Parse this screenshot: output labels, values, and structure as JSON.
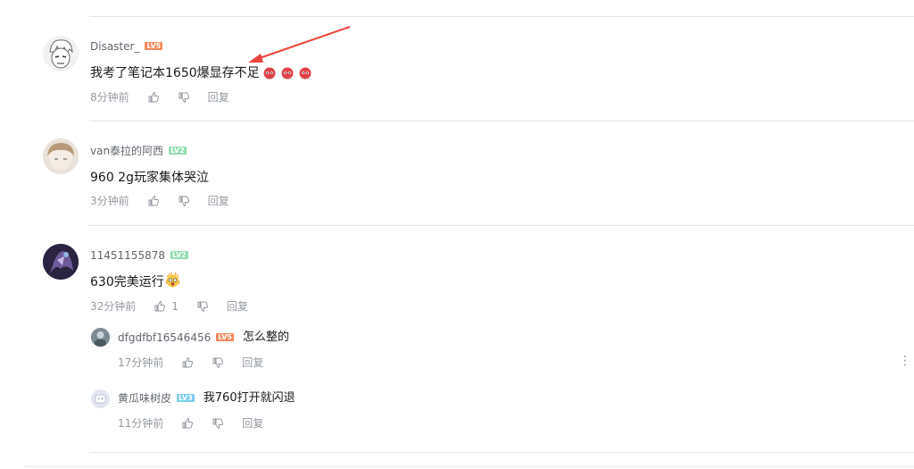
{
  "comments": [
    {
      "username": "Disaster_",
      "level": "LV5",
      "level_color": "#f6885b",
      "text": "我考了笔记本1650爆显存不足",
      "emoji_count": 3,
      "time": "8分钟前",
      "like_count": "",
      "reply_label": "回复"
    },
    {
      "username": "van泰拉的阿西",
      "level": "LV2",
      "level_color": "#95ddb2",
      "text": "960 2g玩家集体哭泣",
      "time": "3分钟前",
      "like_count": "",
      "reply_label": "回复"
    },
    {
      "username": "11451155878",
      "level": "LV2",
      "level_color": "#95ddb2",
      "text": "630完美运行",
      "time": "32分钟前",
      "like_count": "1",
      "reply_label": "回复",
      "replies": [
        {
          "username": "dfgdfbf16546456",
          "level": "LV5",
          "level_color": "#f6885b",
          "text": "怎么整的",
          "time": "17分钟前",
          "reply_label": "回复"
        },
        {
          "username": "黄瓜味树皮",
          "level": "LV3",
          "level_color": "#7bcdef",
          "text": "我760打开就闪退",
          "time": "11分钟前",
          "reply_label": "回复"
        }
      ]
    }
  ],
  "icons": {
    "like": "thumbs-up-icon",
    "dislike": "thumbs-down-icon",
    "emoji": "angry-face-emoji",
    "more": "more-vertical-icon"
  }
}
